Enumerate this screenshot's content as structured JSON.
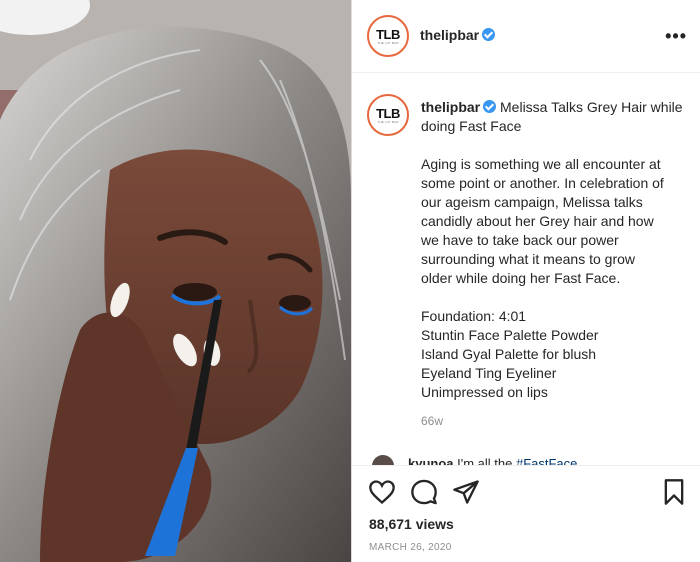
{
  "post": {
    "username": "thelipbar",
    "avatar_logo": "TLB",
    "avatar_logo_sub": "THE LIP BAR",
    "more_label": "•••",
    "caption_title": "Melissa Talks Grey Hair while doing Fast Face",
    "caption_lines": [
      "Aging is something we all encounter at",
      "some point or another. In celebration of",
      "our ageism campaign, Melissa talks",
      "candidly about her Grey hair and how",
      "we have to take back our power",
      "surrounding what it means to grow",
      "older while doing her Fast Face."
    ],
    "product_lines": [
      "Foundation: 4:01",
      "Stuntin Face Palette Powder",
      "Island Gyal Palette for blush",
      "Eyeland Ting Eyeliner",
      "Unimpressed on lips"
    ],
    "time_ago": "66w",
    "comment_preview": {
      "user": "kyunoa",
      "text": " I'm all the ",
      "tag": "#FastFace"
    },
    "views": "88,671 views",
    "date": "MARCH 26, 2020"
  },
  "icons": {
    "like": "heart-icon",
    "comment": "comment-icon",
    "share": "paper-plane-icon",
    "save": "bookmark-icon"
  },
  "colors": {
    "verified": "#3897f0",
    "avatar_ring": "#e6683c",
    "text": "#262626",
    "muted": "#8e8e8e",
    "eyeliner_blue": "#1e73d8"
  }
}
